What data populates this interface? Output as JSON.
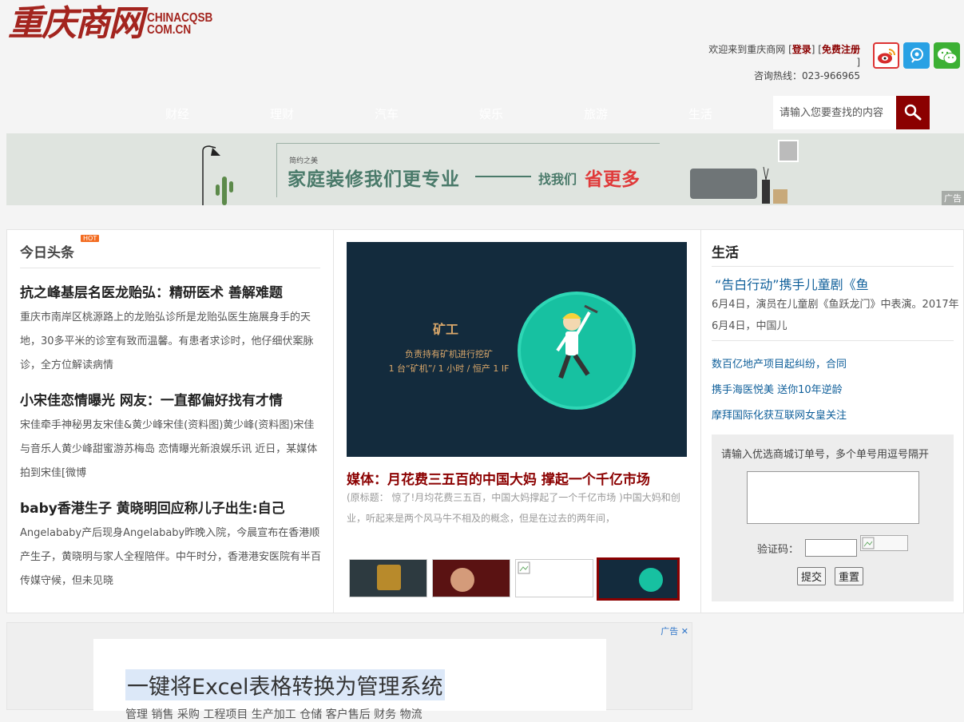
{
  "site": {
    "logo_cn": "重庆商网",
    "logo_en": "CHINACQSB COM.CN",
    "welcome_prefix": "欢迎来到重庆商网 [",
    "login": "登录",
    "register_sep": "] [",
    "register": "免费注册",
    "welcome_suffix": "]",
    "hotline": "咨询热线：023-966965"
  },
  "nav": {
    "items": [
      "财经",
      "理财",
      "汽车",
      "娱乐",
      "旅游",
      "生活"
    ],
    "search_placeholder": "请输入您要查找的内容"
  },
  "banner": {
    "small": "简约之美",
    "main": "家庭装修我们更专业",
    "find": "找我们",
    "save": "省更多",
    "ad_tag": "广告"
  },
  "headlines": {
    "title": "今日头条",
    "hot": "HOT",
    "articles": [
      {
        "title": "抗之峰基层名医龙贻弘：精研医术 善解难题",
        "summary": "重庆市南岸区桃源路上的龙贻弘诊所是龙贻弘医生施展身手的天地，30多平米的诊室有致而温馨。有患者求诊时，他仔细伏案脉诊，全方位解读病情"
      },
      {
        "title": "小宋佳恋情曝光 网友：一直都偏好找有才情",
        "summary": "宋佳牵手神秘男友宋佳&黄少峰宋佳(资料图)黄少峰(资料图)宋佳与音乐人黄少峰甜蜜游苏梅岛 恋情曝光新浪娱乐讯 近日，某媒体拍到宋佳[微博"
      },
      {
        "title": "baby香港生子 黄晓明回应称儿子出生:自己",
        "summary": "Angelababy产后现身Angelababy昨晚入院，今晨宣布在香港顺产生子，黄晓明与家人全程陪伴。中午时分，香港港安医院有半百传媒守候，但未见晓"
      }
    ]
  },
  "feature": {
    "img_title": "矿工",
    "img_line1": "负责持有矿机进行挖矿",
    "img_line2": "1 台“矿机”/ 1 小时 / 恒产 1 IF",
    "title": "媒体：月花费三五百的中国大妈 撑起一个千亿市场",
    "desc": "(原标题： 惊了!月均花费三五百，中国大妈撑起了一个千亿市场 )中国大妈和创业，听起来是两个风马牛不相及的概念，但是在过去的两年间，"
  },
  "life": {
    "title": "生活",
    "headline": "“告白行动”携手儿童剧《鱼",
    "desc": "6月4日，演员在儿童剧《鱼跃龙门》中表演。2017年6月4日，中国儿",
    "links": [
      "数百亿地产项目起纠纷，合同",
      "携手海医悦美 送你10年逆龄",
      "摩拜国际化获互联网女皇关注"
    ]
  },
  "order_form": {
    "hint": "请输入优选商城订单号，多个单号用逗号隔开",
    "captcha_label": "验证码：",
    "submit": "提交",
    "reset": "重置"
  },
  "bottom_ad": {
    "label": "广告",
    "close": "✕",
    "headline": "一键将Excel表格转换为管理系统",
    "sub": "管理  销售  采购  工程项目  生产加工  仓储  客户售后  财务  物流"
  },
  "colors": {
    "brand": "#8b0000",
    "link": "#0f5f9a",
    "hot": "#f36c21"
  }
}
